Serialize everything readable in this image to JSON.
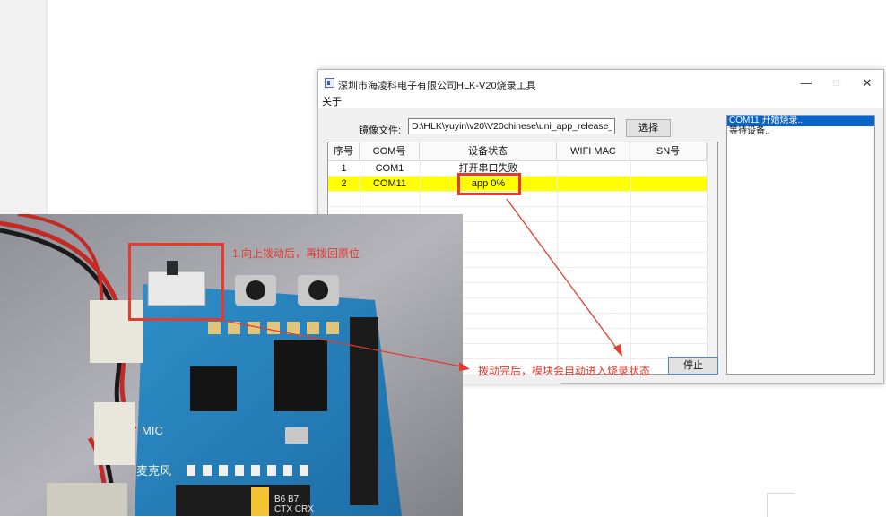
{
  "window": {
    "title": "深圳市海凌科电子有限公司HLK-V20烧录工具",
    "controls": {
      "minimize": "—",
      "maximize": "□",
      "close": "✕"
    },
    "menu": [
      "关于"
    ]
  },
  "image_file": {
    "label": "镜像文件:",
    "value": "D:\\HLK\\yuyin\\v20\\V20chinese\\uni_app_release_updat",
    "select_button": "选择"
  },
  "table": {
    "columns": [
      "序号",
      "COM号",
      "设备状态",
      "WIFI MAC",
      "SN号"
    ],
    "rows": [
      {
        "index": "1",
        "com": "COM1",
        "status": "打开串口失败",
        "wifi_mac": "",
        "sn": "",
        "highlight": false
      },
      {
        "index": "2",
        "com": "COM11",
        "status": "app 0%",
        "wifi_mac": "",
        "sn": "",
        "highlight": true
      }
    ]
  },
  "stop_button": "停止",
  "log": [
    {
      "text": "COM11 开始烧录..",
      "selected": true
    },
    {
      "text": "等待设备..",
      "selected": false
    }
  ],
  "annotations": {
    "step1": "1.向上拨动后，再拨回原位",
    "step2": "拨动完后，模块会自动进入烧录状态"
  },
  "board_labels": {
    "mic": "MIC",
    "mic_cn": "麦克风",
    "pins_top": "B6 B7",
    "pins_bottom": "CTX CRX"
  },
  "colors": {
    "highlight_row": "#ffff00",
    "annotation": "#e53a2e",
    "selection": "#0a64c8"
  }
}
